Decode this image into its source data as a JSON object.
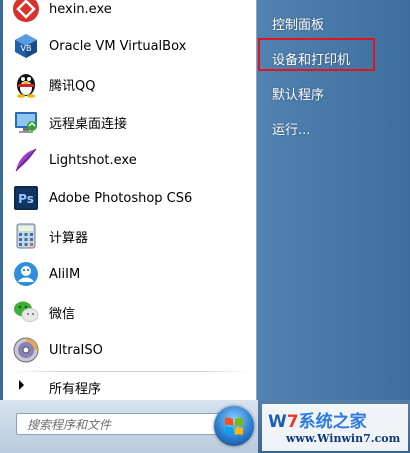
{
  "programs": [
    {
      "label": "hexin.exe",
      "icon": "hexin-icon"
    },
    {
      "label": "Oracle VM VirtualBox",
      "icon": "virtualbox-icon"
    },
    {
      "label": "腾讯QQ",
      "icon": "qq-penguin-icon"
    },
    {
      "label": "远程桌面连接",
      "icon": "remote-desktop-icon"
    },
    {
      "label": "Lightshot.exe",
      "icon": "lightshot-feather-icon"
    },
    {
      "label": "Adobe Photoshop CS6",
      "icon": "photoshop-icon"
    },
    {
      "label": "计算器",
      "icon": "calculator-icon"
    },
    {
      "label": "AliIM",
      "icon": "aliim-icon"
    },
    {
      "label": "微信",
      "icon": "wechat-icon"
    },
    {
      "label": "UltraISO",
      "icon": "ultraiso-disc-icon"
    }
  ],
  "all_programs_label": "所有程序",
  "search": {
    "placeholder": "搜索程序和文件"
  },
  "right_items": [
    {
      "label": "控制面板"
    },
    {
      "label": "设备和打印机"
    },
    {
      "label": "默认程序"
    },
    {
      "label": "运行..."
    }
  ],
  "highlighted_item": "设备和打印机",
  "watermark": {
    "main_prefix": "W",
    "main_7": "7",
    "main_cn": "系统之家",
    "url": "www.Winwin7.com"
  },
  "colors": {
    "highlight": "#e0141a",
    "menu_bg": "#4a7aa8"
  }
}
